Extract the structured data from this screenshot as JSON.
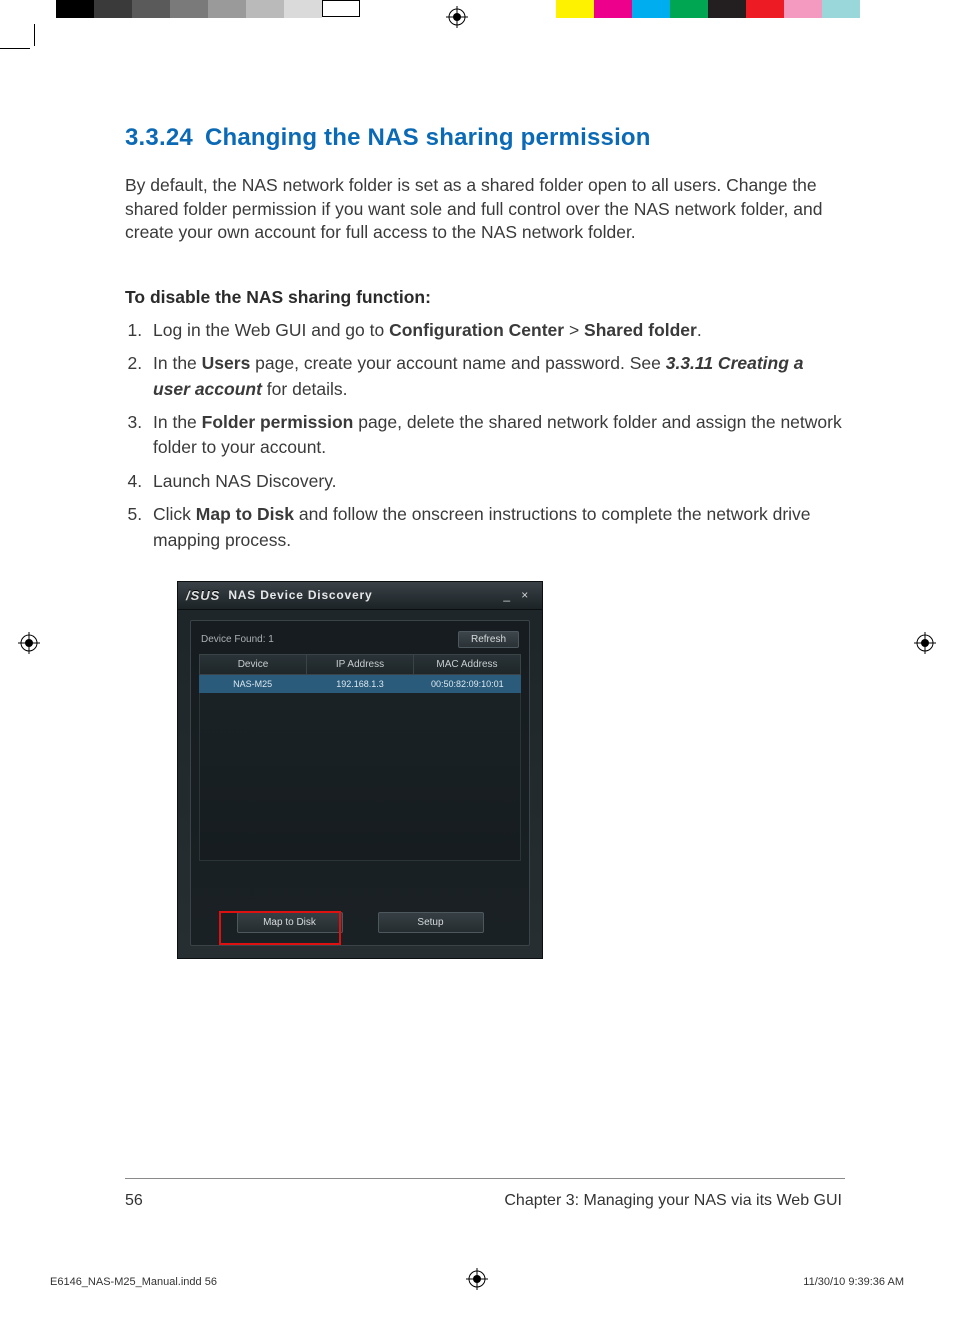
{
  "heading": {
    "num": "3.3.24",
    "title": "Changing the NAS sharing permission"
  },
  "intro": "By default, the NAS network folder is set as a shared folder open to all users. Change the shared folder permission if you want sole and full control over the NAS network folder, and create your own account for full access to the NAS network folder.",
  "subhead": "To disable the NAS sharing function:",
  "steps": {
    "s1a": "Log in the Web GUI and go to ",
    "s1b": "Configuration Center",
    "s1c": " > ",
    "s1d": "Shared folder",
    "s1e": ".",
    "s2a": "In the ",
    "s2b": "Users",
    "s2c": " page, create your account name and password. See ",
    "s2d": "3.3.11 Creating a user account",
    "s2e": " for details.",
    "s3a": "In the ",
    "s3b": "Folder permission",
    "s3c": " page, delete the shared network folder and assign the network folder to your account.",
    "s4": " Launch NAS Discovery.",
    "s5a": "Click ",
    "s5b": "Map to Disk",
    "s5c": " and follow the onscreen instructions to complete the network drive mapping process."
  },
  "shot": {
    "brand": "/SUS",
    "title": "NAS Device Discovery",
    "minimize": "_",
    "close": "×",
    "found_label": "Device Found: 1",
    "refresh": "Refresh",
    "th_device": "Device",
    "th_ip": "IP Address",
    "th_mac": "MAC Address",
    "row_device": "NAS-M25",
    "row_ip": "192.168.1.3",
    "row_mac": "00:50:82:09:10:01",
    "map_btn": "Map to Disk",
    "setup_btn": "Setup"
  },
  "footer": {
    "page": "56",
    "chapter": "Chapter 3: Managing your NAS via its Web GUI",
    "slug_file": "E6146_NAS-M25_Manual.indd   56",
    "slug_time": "11/30/10   9:39:36 AM"
  },
  "colors": {
    "gray1": "#000000",
    "gray2": "#3a3a3a",
    "gray3": "#5a5a5a",
    "gray4": "#7a7a7a",
    "gray5": "#9a9a9a",
    "gray6": "#bababa",
    "gray7": "#dadada",
    "gray8": "#ffffff",
    "y": "#fff200",
    "m": "#ec008c",
    "c": "#00aeef",
    "g": "#00a651",
    "k": "#231f20",
    "r": "#ed1c24",
    "pk": "#f49ac1",
    "lb": "#9ad7db"
  }
}
